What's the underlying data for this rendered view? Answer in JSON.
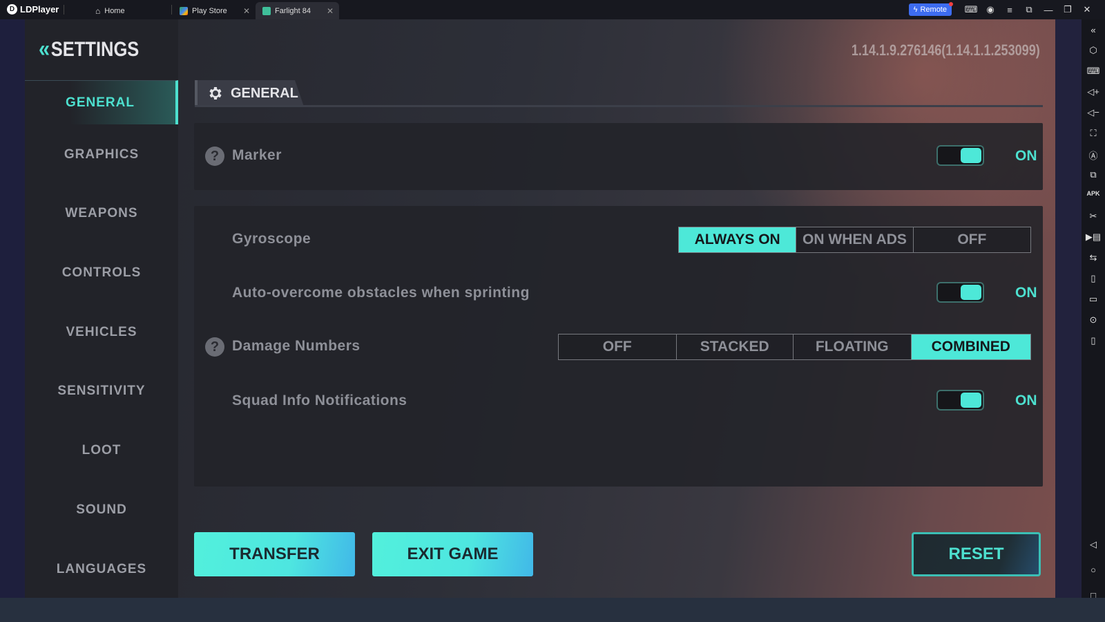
{
  "titlebar": {
    "app_name": "LDPlayer",
    "tabs": [
      {
        "label": "Home",
        "icon": "home-icon",
        "closable": false
      },
      {
        "label": "Play Store",
        "icon": "play-store-icon",
        "closable": true
      },
      {
        "label": "Farlight 84",
        "icon": "farlight-icon",
        "closable": true,
        "active": true
      }
    ],
    "remote_label": "Remote",
    "icons": [
      "gamepad-icon",
      "account-icon",
      "menu-icon",
      "resize-icon",
      "minimize-icon",
      "restore-icon",
      "close-icon"
    ]
  },
  "right_toolbar": {
    "icons": [
      "settings-icon",
      "keyboard-icon",
      "volume-up-icon",
      "volume-down-icon",
      "screenshot-icon",
      "auto-rotate-icon",
      "multi-instance-icon",
      "apk-install-icon",
      "scissors-icon",
      "record-icon",
      "sync-icon",
      "shake-icon",
      "folder-icon",
      "location-icon",
      "rotate-icon"
    ],
    "nav_icons": [
      "back-icon",
      "home-circle-icon",
      "recent-apps-icon"
    ]
  },
  "settings": {
    "title": "SETTINGS",
    "version": "1.14.1.9.276146(1.14.1.1.253099)",
    "nav": [
      {
        "label": "GENERAL",
        "active": true
      },
      {
        "label": "GRAPHICS"
      },
      {
        "label": "WEAPONS"
      },
      {
        "label": "CONTROLS"
      },
      {
        "label": "VEHICLES"
      },
      {
        "label": "SENSITIVITY"
      },
      {
        "label": "LOOT"
      },
      {
        "label": "SOUND"
      },
      {
        "label": "LANGUAGES"
      }
    ],
    "section_title": "GENERAL",
    "marker": {
      "label": "Marker",
      "state": "ON"
    },
    "gyroscope": {
      "label": "Gyroscope",
      "options": [
        "ALWAYS ON",
        "ON WHEN ADS",
        "OFF"
      ],
      "selected": "ALWAYS ON"
    },
    "auto_overcome": {
      "label": "Auto-overcome obstacles when sprinting",
      "state": "ON"
    },
    "damage_numbers": {
      "label": "Damage Numbers",
      "options": [
        "OFF",
        "STACKED",
        "FLOATING",
        "COMBINED"
      ],
      "selected": "COMBINED"
    },
    "squad_info": {
      "label": "Squad Info Notifications",
      "state": "ON"
    },
    "buttons": {
      "transfer": "TRANSFER",
      "exit_game": "EXIT GAME",
      "reset": "RESET"
    }
  },
  "colors": {
    "accent": "#4de8d8",
    "remote": "#3d6cf0"
  }
}
